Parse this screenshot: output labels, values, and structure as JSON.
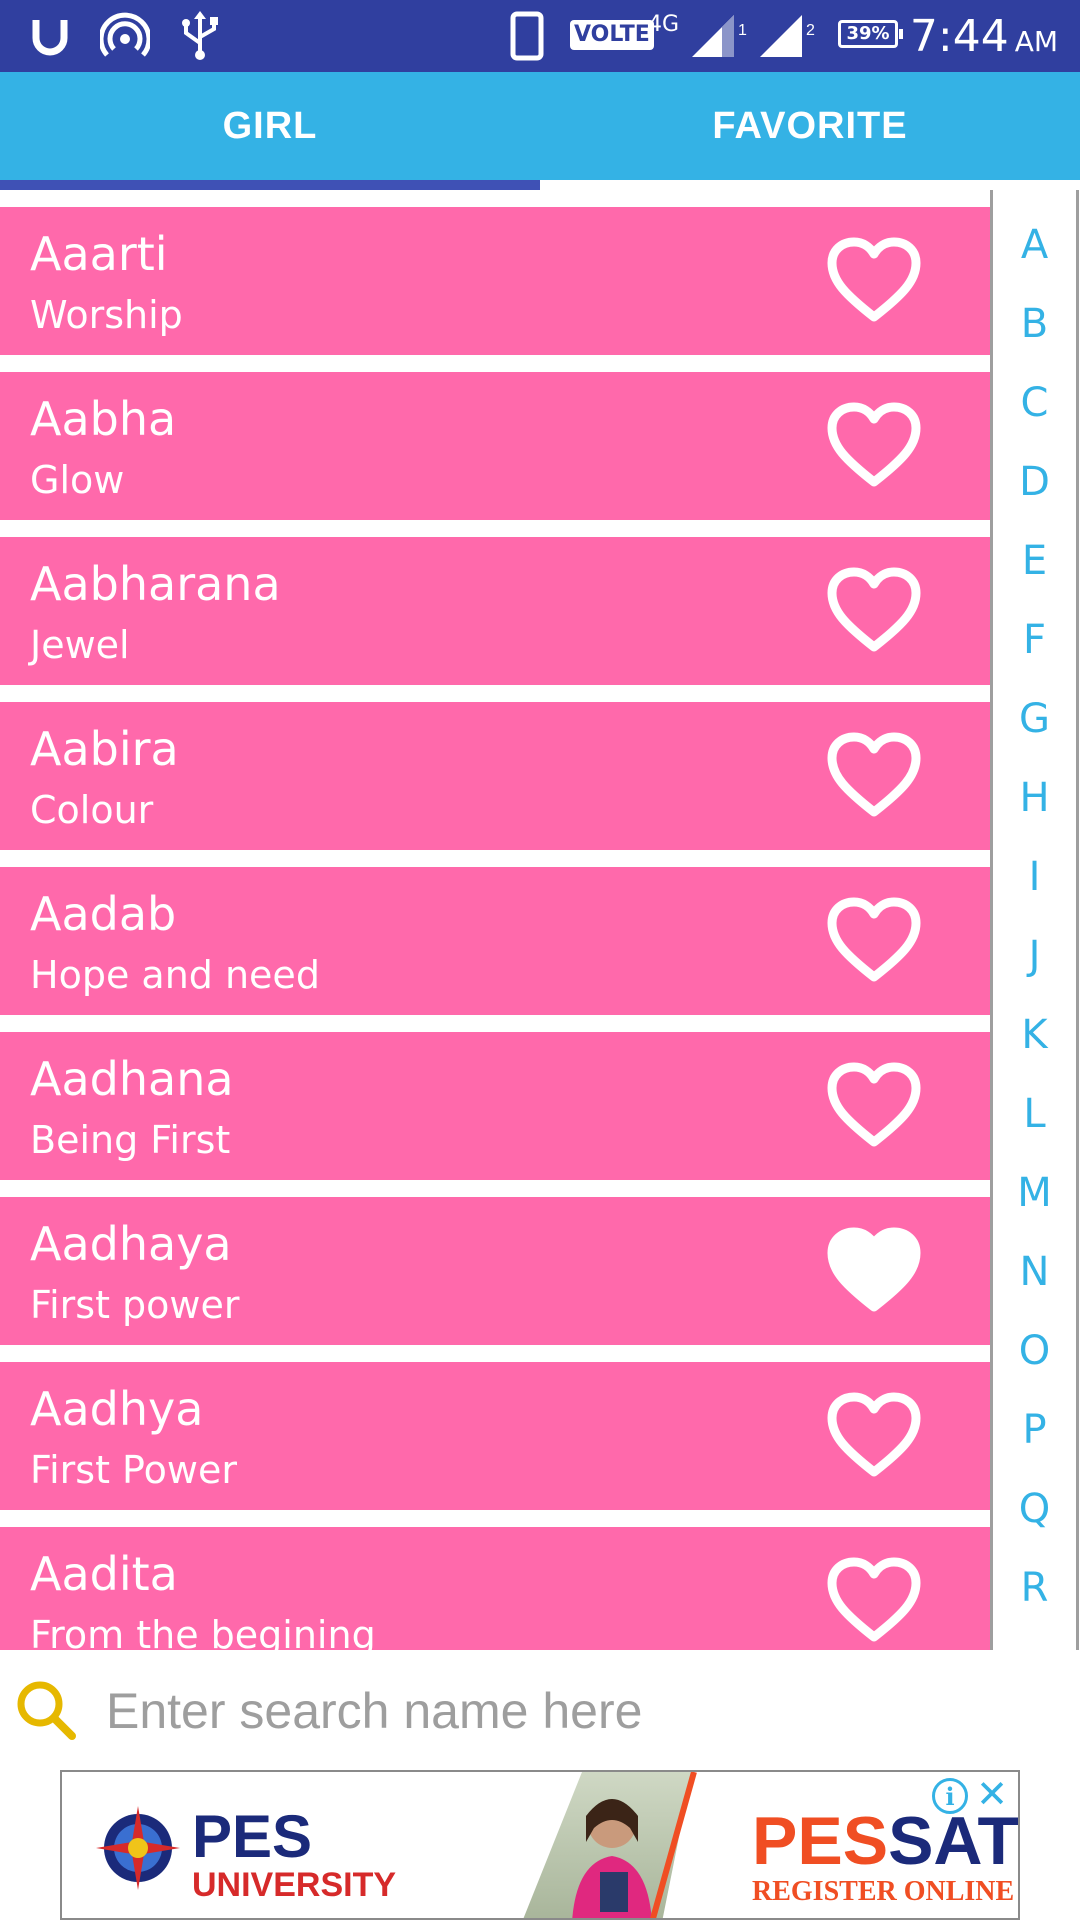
{
  "status_bar": {
    "icons": [
      "u-icon",
      "hotspot-icon",
      "usb-icon",
      "phone-icon",
      "signal-icon-sim1",
      "signal-icon-sim2",
      "battery-icon"
    ],
    "volte": "VOLTE",
    "network": "4G",
    "sim1_label": "1",
    "sim2_label": "2",
    "battery": "39%",
    "time": "7:44",
    "ampm": "AM"
  },
  "tabs": [
    {
      "label": "GIRL",
      "selected": true
    },
    {
      "label": "FAVORITE",
      "selected": false
    }
  ],
  "list": [
    {
      "name": "Aaarti",
      "meaning": "Worship",
      "favorite": false
    },
    {
      "name": "Aabha",
      "meaning": "Glow",
      "favorite": false
    },
    {
      "name": "Aabharana",
      "meaning": "Jewel",
      "favorite": false
    },
    {
      "name": "Aabira",
      "meaning": "Colour",
      "favorite": false
    },
    {
      "name": "Aadab",
      "meaning": "Hope and need",
      "favorite": false
    },
    {
      "name": "Aadhana",
      "meaning": "Being First",
      "favorite": false
    },
    {
      "name": "Aadhaya",
      "meaning": "First power",
      "favorite": true
    },
    {
      "name": "Aadhya",
      "meaning": "First Power",
      "favorite": false
    },
    {
      "name": "Aadita",
      "meaning": "From the begining",
      "favorite": false
    }
  ],
  "alphabet": [
    "A",
    "B",
    "C",
    "D",
    "E",
    "F",
    "G",
    "H",
    "I",
    "J",
    "K",
    "L",
    "M",
    "N",
    "O",
    "P",
    "Q",
    "R"
  ],
  "search": {
    "placeholder": "Enter search name here",
    "value": ""
  },
  "ad": {
    "left_title": "PES",
    "left_subtitle": "UNIVERSITY",
    "right_title_part1": "PES",
    "right_title_part2": "SAT",
    "right_subtitle": "REGISTER ONLINE",
    "info": "i",
    "close": "✕"
  },
  "colors": {
    "status_bar": "#303F9F",
    "tab_bar": "#34B2E5",
    "tab_indicator": "#3F51B5",
    "list_item": "#FF69AB",
    "alphabet": "#34B2E5",
    "search_icon": "#E6B800"
  }
}
